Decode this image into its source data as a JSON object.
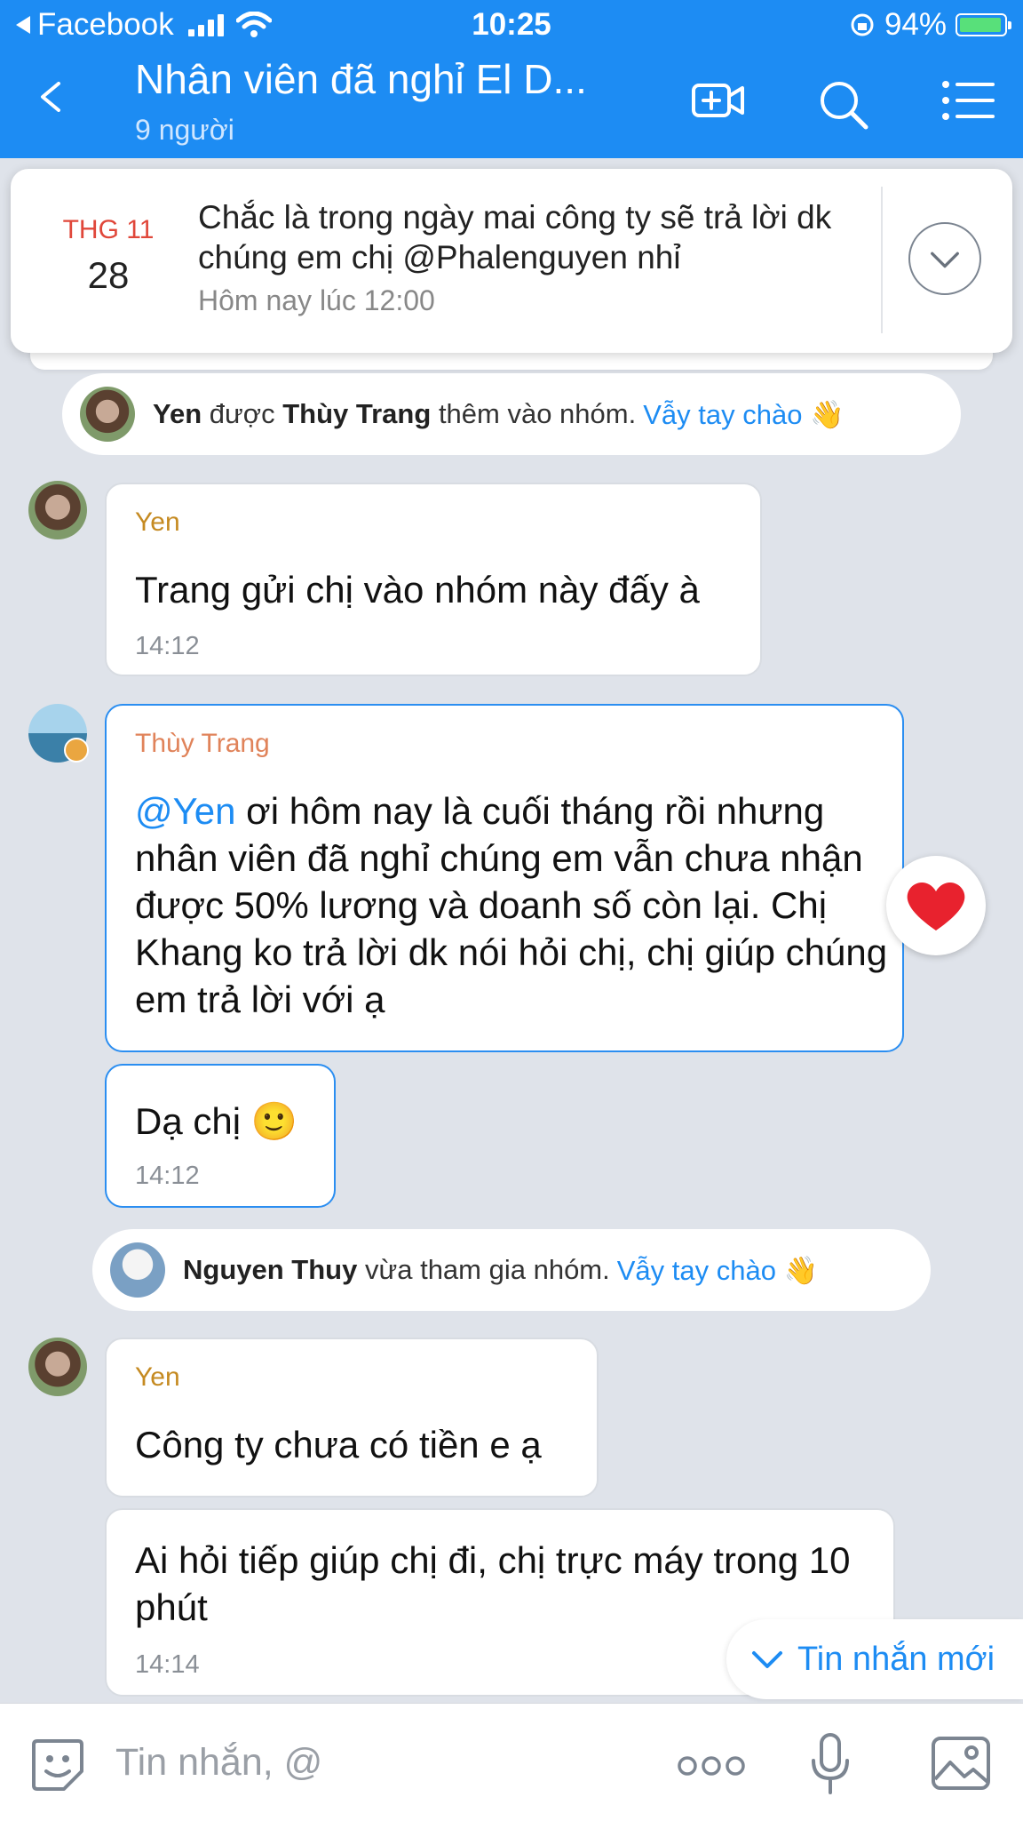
{
  "status_bar": {
    "back_app": "Facebook",
    "time": "10:25",
    "battery": "94%"
  },
  "header": {
    "title": "Nhân viên đã nghỉ El D...",
    "subtitle": "9 người"
  },
  "pinned": {
    "month": "THG 11",
    "day": "28",
    "text": "Chắc là trong ngày mai công ty sẽ trả lời dk chúng em chị @Phalenguyen nhỉ",
    "time": "Hôm nay lúc 12:00"
  },
  "notices": [
    {
      "name": "Yen",
      "verb": "được",
      "actor": "Thùy Trang",
      "rest": "thêm vào nhóm.",
      "wave": "Vẫy tay chào 👋"
    },
    {
      "name": "Nguyen Thuy",
      "rest": "vừa tham gia nhóm.",
      "wave": "Vẫy tay chào 👋"
    }
  ],
  "messages": [
    {
      "sender": "Yen",
      "sender_color": "#c58a21",
      "text": "Trang gửi chị vào nhóm này đấy à",
      "time": "14:12"
    },
    {
      "sender": "Thùy Trang",
      "sender_color": "#e0835a",
      "mention": "@Yen",
      "text": " ơi hôm nay là cuối tháng rồi nhưng nhân viên đã nghỉ chúng em vẫn chưa nhận được 50% lương và doanh số còn lại. Chị Khang ko trả lời dk nói hỏi chị, chị giúp chúng em trả lời với ạ",
      "reaction": "heart"
    },
    {
      "text": "Dạ chị 🙂",
      "time": "14:12"
    },
    {
      "sender": "Yen",
      "sender_color": "#c58a21",
      "text": "Công ty chưa có tiền e ạ"
    },
    {
      "text": "Ai hỏi tiếp giúp chị đi, chị trực máy trong 10 phút",
      "time": "14:14"
    }
  ],
  "new_messages_label": "Tin nhắn mới",
  "input": {
    "placeholder": "Tin nhắn, @"
  },
  "icons": [
    "back-icon",
    "video-call-icon",
    "search-icon",
    "menu-icon",
    "chevron-down-icon",
    "sticker-icon",
    "more-icon",
    "mic-icon",
    "image-icon"
  ],
  "colors": {
    "header_blue": "#1d8cf3",
    "mention_blue": "#1d8cf3",
    "date_red": "#e0473a"
  }
}
